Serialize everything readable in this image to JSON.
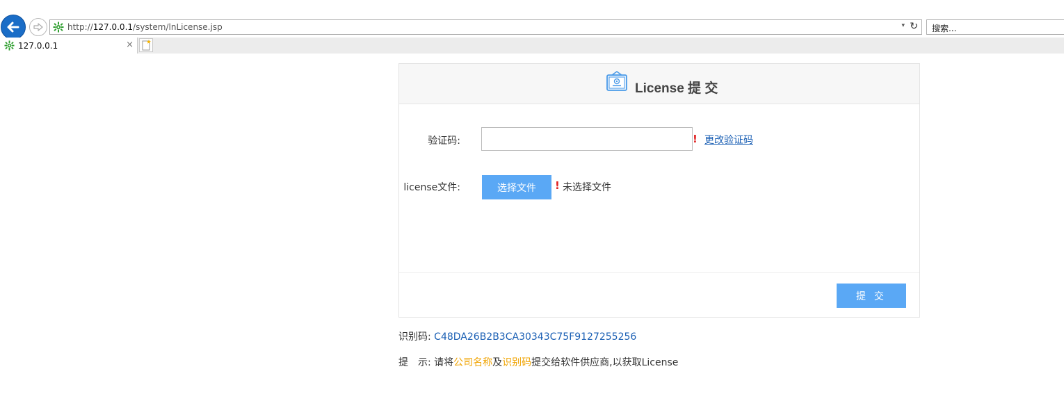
{
  "browser": {
    "url_prefix": "http://",
    "url_host": "127.0.0.1",
    "url_path": "/system/lnLicense.jsp",
    "search_placeholder": "搜索...",
    "tab_title": "127.0.0.1",
    "tab_close": "×",
    "dropdown_glyph": "▾",
    "refresh_glyph": "↻"
  },
  "panel": {
    "title": "License 提 交",
    "captcha_label": "验证码:",
    "captcha_value": "",
    "change_captcha_link": "更改验证码",
    "required_mark": "!",
    "license_label": "license文件:",
    "choose_file_button": "选择文件",
    "no_file_text": "未选择文件",
    "submit_button": "提 交"
  },
  "info": {
    "idcode_label": "识别码: ",
    "idcode_value": "C48DA26B2B3CA30343C75F9127255256",
    "tip_label": "提　示: ",
    "tip_part1": "请将",
    "tip_highlight1": "公司名称",
    "tip_part2": "及",
    "tip_highlight2": "识别码",
    "tip_part3": "提交给软件供应商,以获取License"
  },
  "colors": {
    "accent_button": "#5aa8f5",
    "link": "#1a5fb4",
    "highlight": "#f0a300",
    "required": "#e02020"
  }
}
